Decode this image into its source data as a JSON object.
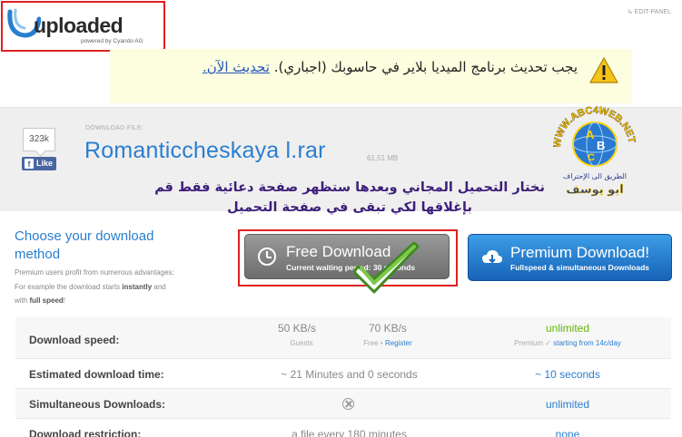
{
  "header": {
    "logo_text": "uploaded",
    "logo_sub": "powered by Cyando AG",
    "edit_panel": "EDIT-PANEL"
  },
  "notice": {
    "text": "يجب تحديث برنامج الميديا بلاير في حاسوبك (اجباري).",
    "link": "تحديث الآن."
  },
  "file": {
    "like_count": "323k",
    "like_label": "Like",
    "download_label": "DOWNLOAD FILE:",
    "name": "Romanticcheskaya l.rar",
    "size": "61,51 MB"
  },
  "annotation": {
    "line1": "نختار التحميل المجاني وبعدها ستظهر صفحة دعائية فقط قم",
    "line2": "بإغلاقها لكي تبقى في صفحة التحميل",
    "watermark": "WWW.ABC4WEB.NET",
    "watermark_sub": "الطريق الى الإحتراف",
    "watermark_name": "ابو يوسف"
  },
  "choose": {
    "title": "Choose your download method",
    "desc1": "Premium users profit from numerous advantages;",
    "desc2": "For example the download starts ",
    "desc_bold1": "instantly",
    "desc3": " and",
    "desc4": "with ",
    "desc_bold2": "full speed",
    "desc5": "!"
  },
  "buttons": {
    "free_title": "Free Download",
    "free_sub": "Current waiting period: 30 seconds",
    "premium_title": "Premium Download!",
    "premium_sub": "Fullspeed & simultaneous Downloads"
  },
  "table": {
    "rows": [
      {
        "label": "Download speed:",
        "guests": "50 KB/s",
        "guests_sub": "Guests",
        "free": "70 KB/s",
        "free_sub": "Free • ",
        "free_link": "Register",
        "premium": "unlimited",
        "premium_sub": "Premium ✓ ",
        "premium_link": "starting from 14c/day"
      },
      {
        "label": "Estimated download time:",
        "center": "~ 21 Minutes and 0 seconds",
        "premium": "~ 10 seconds"
      },
      {
        "label": "Simultaneous Downloads:",
        "premium": "unlimited"
      },
      {
        "label": "Download restriction:",
        "center": "a file every 180 minutes",
        "premium": "none"
      }
    ]
  },
  "colors": {
    "accent_blue": "#2a7ecf",
    "premium_green": "#64b40a",
    "highlight_red": "#e02020",
    "notice_bg": "#fdfde0"
  }
}
